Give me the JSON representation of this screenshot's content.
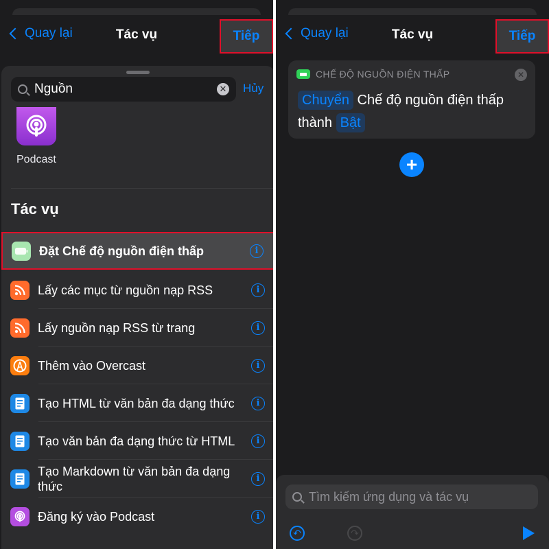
{
  "left": {
    "nav": {
      "back_label": "Quay lại",
      "title": "Tác vụ",
      "next_label": "Tiếp"
    },
    "search": {
      "query": "Nguồn",
      "cancel_label": "Hủy"
    },
    "app_result": {
      "label": "Podcast",
      "icon": "podcast-icon"
    },
    "section_title": "Tác vụ",
    "actions": [
      {
        "label": "Đặt Chế độ nguồn điện thấp",
        "icon": "battery-icon",
        "color": "#30d158",
        "highlighted": true
      },
      {
        "label": "Lấy các mục từ nguồn nạp RSS",
        "icon": "rss-icon",
        "color": "#ff6b2c"
      },
      {
        "label": "Lấy nguồn nạp RSS từ trang",
        "icon": "rss-icon",
        "color": "#ff6b2c"
      },
      {
        "label": "Thêm vào Overcast",
        "icon": "overcast-icon",
        "color": "#fc7e0f"
      },
      {
        "label": "Tạo HTML từ văn bản đa dạng thức",
        "icon": "document-icon",
        "color": "#1e88e5"
      },
      {
        "label": "Tạo văn bản đa dạng thức từ HTML",
        "icon": "document-icon",
        "color": "#1e88e5"
      },
      {
        "label": "Tạo Markdown từ văn bản đa dạng thức",
        "icon": "document-icon",
        "color": "#1e88e5"
      },
      {
        "label": "Đăng ký vào Podcast",
        "icon": "podcast-icon",
        "color": "#b44ee0"
      }
    ]
  },
  "right": {
    "nav": {
      "back_label": "Quay lại",
      "title": "Tác vụ",
      "next_label": "Tiếp"
    },
    "card": {
      "title": "CHẾ ĐỘ NGUỒN ĐIỆN THẤP",
      "verb_token": "Chuyển",
      "text_middle": "Chế độ nguồn điện thấp",
      "text_prefix": "thành",
      "value_token": "Bật"
    },
    "bottom": {
      "search_placeholder": "Tìm kiếm ứng dụng và tác vụ"
    }
  },
  "colors": {
    "accent": "#0a84ff",
    "highlight_border": "#e0102a",
    "background": "#1c1c1e"
  }
}
